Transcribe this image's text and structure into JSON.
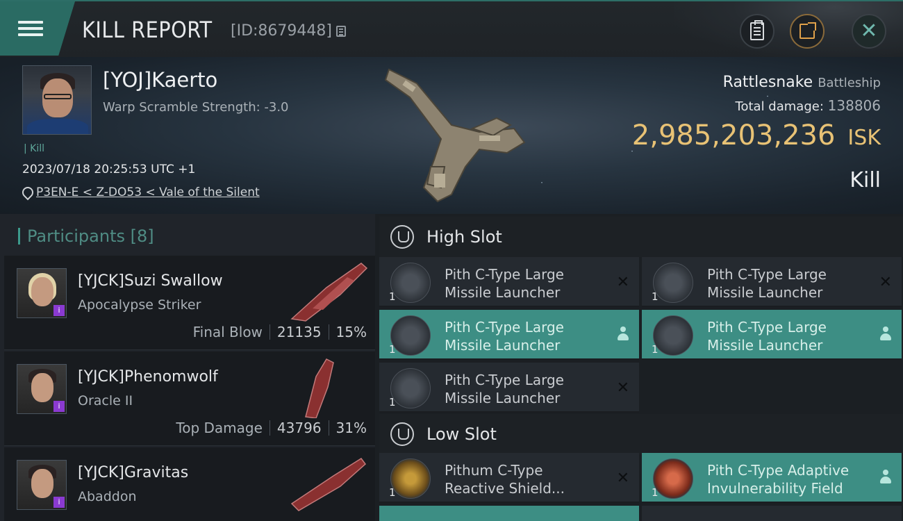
{
  "header": {
    "title": "KILL REPORT",
    "report_id": "[ID:8679448]"
  },
  "victim": {
    "name": "[YOJ]Kaerto",
    "warp_scramble": "Warp Scramble Strength: -3.0",
    "kill_tag": "Kill",
    "datetime": "2023/07/18 20:25:53 UTC +1",
    "location": "P3EN-E < Z-DO53 < Vale of the Silent"
  },
  "ship": {
    "name": "Rattlesnake",
    "class": "Battleship",
    "total_damage_label": "Total damage:",
    "total_damage": "138806",
    "isk_value": "2,985,203,236",
    "isk_unit": "ISK",
    "outcome": "Kill"
  },
  "participants": {
    "label": "Participants",
    "count": "[8]",
    "rows": [
      {
        "name": "[YJCK]Suzi Swallow",
        "ship": "Apocalypse Striker",
        "tag": "Final Blow",
        "damage": "21135",
        "percent": "15%"
      },
      {
        "name": "[YJCK]Phenomwolf",
        "ship": "Oracle II",
        "tag": "Top Damage",
        "damage": "43796",
        "percent": "31%"
      },
      {
        "name": "[YJCK]Gravitas",
        "ship": "Abaddon",
        "tag": "",
        "damage": "",
        "percent": ""
      }
    ]
  },
  "modules": {
    "high_slot_label": "High Slot",
    "low_slot_label": "Low Slot",
    "high": [
      {
        "name": "Pith C-Type Large Missile Launcher",
        "qty": "1",
        "state": "destroyed"
      },
      {
        "name": "Pith C-Type Large Missile Launcher",
        "qty": "1",
        "state": "destroyed"
      },
      {
        "name": "Pith C-Type Large Missile Launcher",
        "qty": "1",
        "state": "dropped"
      },
      {
        "name": "Pith C-Type Large Missile Launcher",
        "qty": "1",
        "state": "dropped"
      },
      {
        "name": "Pith C-Type Large Missile Launcher",
        "qty": "1",
        "state": "destroyed"
      }
    ],
    "low": [
      {
        "name": "Pithum C-Type Reactive Shield...",
        "qty": "1",
        "state": "destroyed"
      },
      {
        "name": "Pith C-Type Adaptive Invulnerability Field",
        "qty": "1",
        "state": "dropped"
      }
    ],
    "destroyed_glyph": "✕"
  },
  "colors": {
    "accent": "#3d8e84",
    "isk": "#e8c275"
  }
}
